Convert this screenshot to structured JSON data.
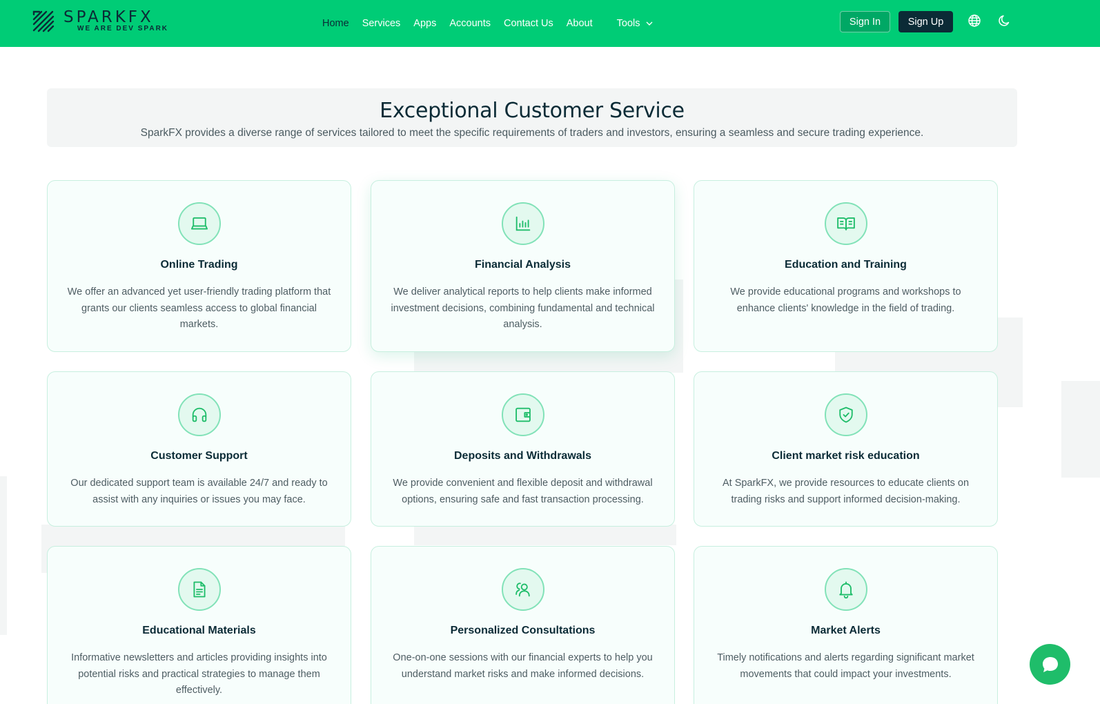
{
  "header": {
    "logo": {
      "name": "SPARKFX",
      "tagline": "WE ARE DEV SPARK"
    },
    "nav": [
      {
        "label": "Home"
      },
      {
        "label": "Services"
      },
      {
        "label": "Apps"
      },
      {
        "label": "Accounts"
      },
      {
        "label": "Contact Us"
      },
      {
        "label": "About"
      }
    ],
    "tools_label": "Tools",
    "sign_in": "Sign In",
    "sign_up": "Sign Up",
    "icons": [
      "globe-icon",
      "moon-icon"
    ]
  },
  "section": {
    "title": "Exceptional Customer Service",
    "subtitle": "SparkFX provides a diverse range of services tailored to meet the specific requirements of traders and investors, ensuring a seamless and secure trading experience."
  },
  "cards": [
    {
      "icon": "laptop-icon",
      "title": "Online Trading",
      "text": "We offer an advanced yet user-friendly trading platform that grants our clients seamless access to global financial markets."
    },
    {
      "icon": "bar-chart-icon",
      "title": "Financial Analysis",
      "text": "We deliver analytical reports to help clients make informed investment decisions, combining fundamental and technical analysis."
    },
    {
      "icon": "open-book-icon",
      "title": "Education and Training",
      "text": "We provide educational programs and workshops to enhance clients' knowledge in the field of trading."
    },
    {
      "icon": "headphones-icon",
      "title": "Customer Support",
      "text": "Our dedicated support team is available 24/7 and ready to assist with any inquiries or issues you may face."
    },
    {
      "icon": "wallet-icon",
      "title": "Deposits and Withdrawals",
      "text": "We provide convenient and flexible deposit and withdrawal options, ensuring safe and fast transaction processing."
    },
    {
      "icon": "shield-check-icon",
      "title": "Client market risk education",
      "text": "At SparkFX, we provide resources to educate clients on trading risks and support informed decision-making."
    },
    {
      "icon": "document-icon",
      "title": "Educational Materials",
      "text": "Informative newsletters and articles providing insights into potential risks and practical strategies to manage them effectively."
    },
    {
      "icon": "users-icon",
      "title": "Personalized Consultations",
      "text": "One-on-one sessions with our financial experts to help you understand market risks and make informed decisions."
    },
    {
      "icon": "bell-icon",
      "title": "Market Alerts",
      "text": "Timely notifications and alerts regarding significant market movements that could impact your investments."
    }
  ],
  "colors": {
    "brand_green": "#00cc76",
    "dark_navy": "#0b2b36",
    "accent_green": "#1fbd6a"
  }
}
